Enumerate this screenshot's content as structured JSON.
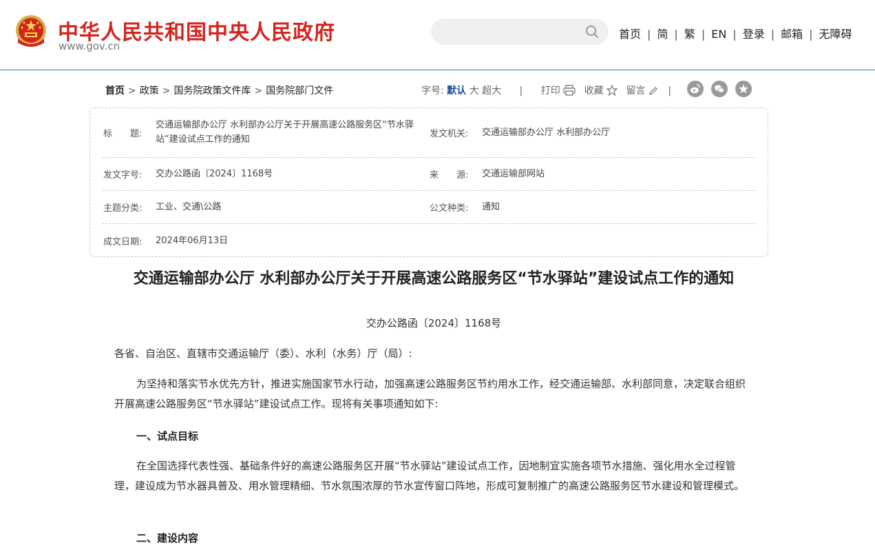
{
  "header": {
    "site_title": "中华人民共和国中央人民政府",
    "site_url": "www.gov.cn",
    "search_placeholder": "",
    "nav": [
      "首页",
      "简",
      "繁",
      "EN",
      "登录",
      "邮箱",
      "无障碍"
    ]
  },
  "breadcrumb": [
    "首页",
    "政策",
    "国务院政策文件库",
    "国务院部门文件"
  ],
  "tools": {
    "font_label": "字号:",
    "font_sizes": [
      "默认",
      "大",
      "超大"
    ],
    "print": "打印",
    "favorite": "收藏",
    "comment": "留言"
  },
  "share_icons": [
    "weibo-icon",
    "wechat-icon",
    "star-icon"
  ],
  "info": {
    "title_label": "标　　题:",
    "title_value": "交通运输部办公厅 水利部办公厅关于开展高速公路服务区“节水驿站”建设试点工作的通知",
    "issuer_label": "发文机关:",
    "issuer_value": "交通运输部办公厅 水利部办公厅",
    "docnum_label": "发文字号:",
    "docnum_value": "交办公路函〔2024〕1168号",
    "source_label": "来　　源:",
    "source_value": "交通运输部网站",
    "topic_label": "主题分类:",
    "topic_value": "工业、交通\\公路",
    "type_label": "公文种类:",
    "type_value": "通知",
    "date_label": "成文日期:",
    "date_value": "2024年06月13日"
  },
  "article": {
    "title": "交通运输部办公厅 水利部办公厅关于开展高速公路服务区“节水驿站”建设试点工作的通知",
    "docnum": "交办公路函〔2024〕1168号",
    "salutation": "各省、自治区、直辖市交通运输厅（委）、水利（水务）厅（局）:",
    "intro": "为坚持和落实节水优先方针，推进实施国家节水行动，加强高速公路服务区节约用水工作，经交通运输部、水利部同意，决定联合组织开展高速公路服务区“节水驿站”建设试点工作。现将有关事项通知如下:",
    "section1": "一、试点目标",
    "section1_text": "在全国选择代表性强、基础条件好的高速公路服务区开展“节水驿站”建设试点工作，因地制宜实施各项节水措施、强化用水全过程管理，建设成为节水器具普及、用水管理精细、节水氛围浓厚的节水宣传窗口阵地，形成可复制推广的高速公路服务区节水建设和管理模式。",
    "section2": "二、建设内容"
  },
  "colors": {
    "brand_red": "#d3251f",
    "link_blue": "#1a4f9c",
    "rule_blue": "#2a72b5"
  }
}
